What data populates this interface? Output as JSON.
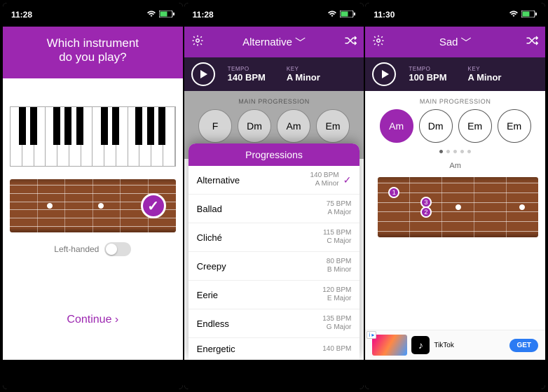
{
  "panel1": {
    "time": "11:28",
    "title_l1": "Which instrument",
    "title_l2": "do you play?",
    "left_handed_label": "Left-handed",
    "continue_label": "Continue ›"
  },
  "panel2": {
    "time": "11:28",
    "genre": "Alternative",
    "tempo_label": "TEMPO",
    "tempo_value": "140 BPM",
    "key_label": "KEY",
    "key_value": "A Minor",
    "section": "MAIN PROGRESSION",
    "chords": [
      "F",
      "Dm",
      "Am",
      "Em"
    ],
    "popup_title": "Progressions",
    "items": [
      {
        "name": "Alternative",
        "bpm": "140 BPM",
        "key": "A Minor",
        "sel": true
      },
      {
        "name": "Ballad",
        "bpm": "75 BPM",
        "key": "A Major",
        "sel": false
      },
      {
        "name": "Cliché",
        "bpm": "115 BPM",
        "key": "C Major",
        "sel": false
      },
      {
        "name": "Creepy",
        "bpm": "80 BPM",
        "key": "B Minor",
        "sel": false
      },
      {
        "name": "Eerie",
        "bpm": "120 BPM",
        "key": "E Major",
        "sel": false
      },
      {
        "name": "Endless",
        "bpm": "135 BPM",
        "key": "G Major",
        "sel": false
      },
      {
        "name": "Energetic",
        "bpm": "140 BPM",
        "key": "",
        "sel": false
      }
    ]
  },
  "panel3": {
    "time": "11:30",
    "genre": "Sad",
    "tempo_label": "TEMPO",
    "tempo_value": "100 BPM",
    "key_label": "KEY",
    "key_value": "A Minor",
    "section": "MAIN PROGRESSION",
    "chords": [
      "Am",
      "Dm",
      "Em",
      "Em"
    ],
    "active_index": 0,
    "chord_name": "Am",
    "fingers": [
      {
        "n": "1",
        "fret": 1,
        "string": 2
      },
      {
        "n": "2",
        "fret": 2,
        "string": 4
      },
      {
        "n": "3",
        "fret": 2,
        "string": 3
      }
    ],
    "string_marks": [
      "×",
      "o",
      "",
      "",
      "",
      "o"
    ],
    "ad": {
      "name": "TikTok",
      "cta": "GET"
    }
  }
}
